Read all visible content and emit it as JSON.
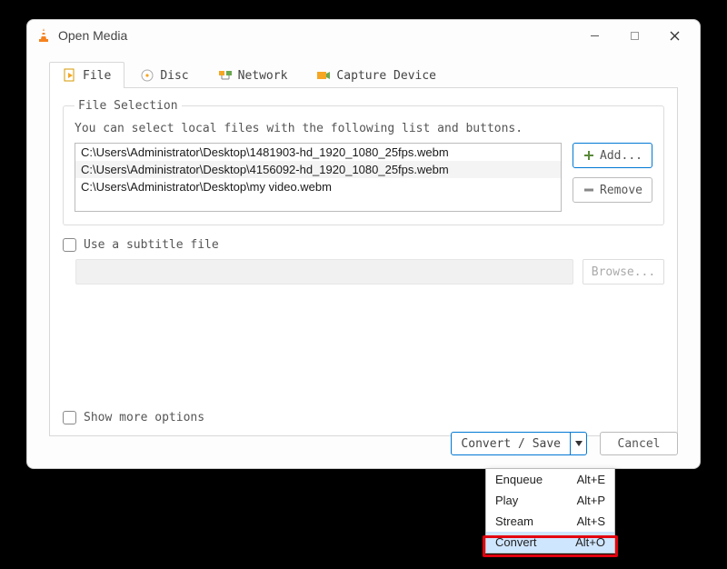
{
  "window": {
    "title": "Open Media"
  },
  "tabs": {
    "file": "File",
    "disc": "Disc",
    "network": "Network",
    "capture": "Capture Device"
  },
  "file_selection": {
    "legend": "File Selection",
    "hint": "You can select local files with the following list and buttons.",
    "files": [
      "C:\\Users\\Administrator\\Desktop\\1481903-hd_1920_1080_25fps.webm",
      "C:\\Users\\Administrator\\Desktop\\4156092-hd_1920_1080_25fps.webm",
      "C:\\Users\\Administrator\\Desktop\\my video.webm"
    ],
    "add_label": "Add...",
    "remove_label": "Remove"
  },
  "subtitle": {
    "checkbox_label": "Use a subtitle file",
    "browse_label": "Browse..."
  },
  "more_options_label": "Show more options",
  "footer": {
    "convert_save": "Convert / Save",
    "cancel": "Cancel"
  },
  "dropdown": {
    "items": [
      {
        "label": "Enqueue",
        "shortcut": "Alt+E"
      },
      {
        "label": "Play",
        "shortcut": "Alt+P"
      },
      {
        "label": "Stream",
        "shortcut": "Alt+S"
      },
      {
        "label": "Convert",
        "shortcut": "Alt+O"
      }
    ]
  }
}
